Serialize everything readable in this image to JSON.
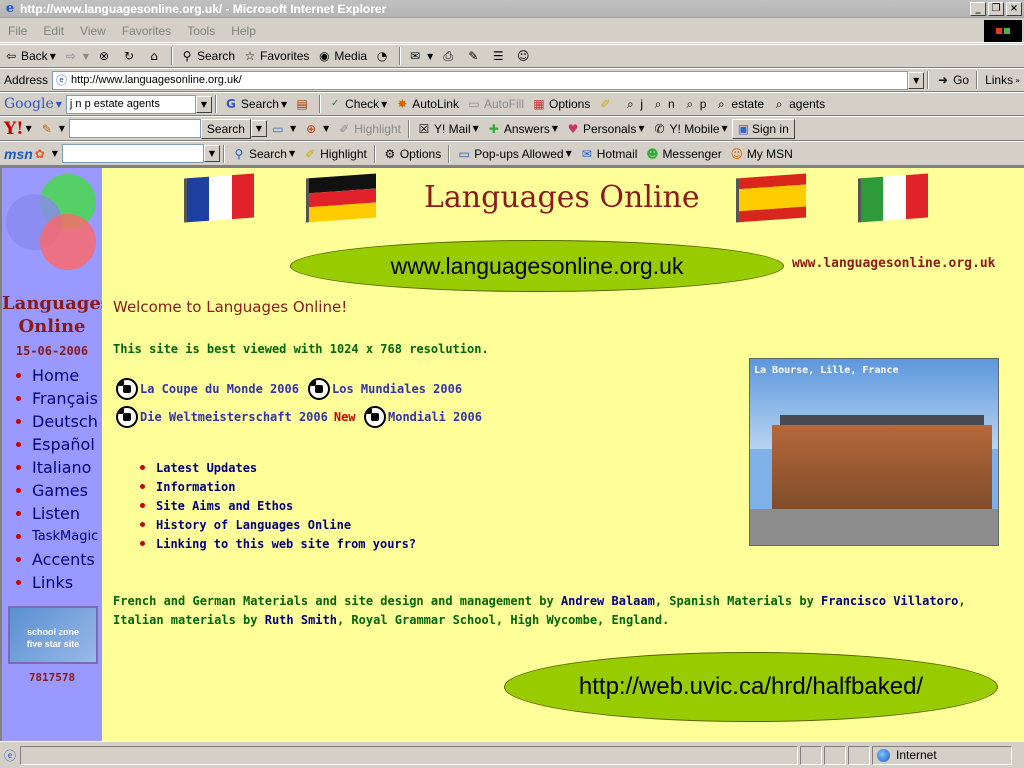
{
  "window": {
    "title": "http://www.languagesonline.org.uk/ - Microsoft Internet Explorer",
    "icon": "ie-icon"
  },
  "menu": [
    "File",
    "Edit",
    "View",
    "Favorites",
    "Tools",
    "Help"
  ],
  "std_toolbar": {
    "back": "Back",
    "search": "Search",
    "favorites": "Favorites",
    "media": "Media"
  },
  "address": {
    "label": "Address",
    "url": "http://www.languagesonline.org.uk/",
    "go": "Go",
    "links": "Links"
  },
  "google": {
    "logo": "Google",
    "query": "j n p estate agents",
    "search": "Search",
    "check": "Check",
    "autolink": "AutoLink",
    "autofill": "AutoFill",
    "options": "Options",
    "terms": [
      "j",
      "n",
      "p",
      "estate",
      "agents"
    ]
  },
  "yahoo": {
    "logo": "Y!",
    "search_btn": "Search",
    "highlight": "Highlight",
    "mail": "Y! Mail",
    "answers": "Answers",
    "personals": "Personals",
    "mobile": "Y! Mobile",
    "signin": "Sign in"
  },
  "msn": {
    "logo": "msn",
    "search": "Search",
    "highlight": "Highlight",
    "options": "Options",
    "popups": "Pop-ups Allowed",
    "hotmail": "Hotmail",
    "messenger": "Messenger",
    "mymsn": "My MSN"
  },
  "page": {
    "title": "Languages Online",
    "url_oval": "www.languagesonline.org.uk",
    "url_right": "www.languagesonline.org.uk",
    "welcome": "Welcome to Languages Online!",
    "best_viewed": "This site is best viewed with 1024 x 768 resolution.",
    "wc1": "La Coupe du Monde 2006",
    "wc2": "Los Mundiales 2006",
    "wc3": "Die Weltmeisterschaft 2006",
    "new_label": "New",
    "wc4": "Mondiali 2006",
    "links": [
      "Latest Updates",
      "Information",
      "Site Aims and Ethos",
      "History of Languages Online",
      "Linking to this web site from yours?"
    ],
    "credits": {
      "p1": "French and German Materials and site design and management by ",
      "n1": "Andrew Balaam",
      "p2": ", Spanish Materials by ",
      "n2": "Francisco Villatoro",
      "p3": ", Italian materials by ",
      "n3": "Ruth Smith",
      "p4": ", Royal Grammar School, High Wycombe, England."
    },
    "photo_caption": "La Bourse, Lille, France",
    "bottom_oval": "http://web.uvic.ca/hrd/halfbaked/"
  },
  "sidebar": {
    "title_line1": "Languages",
    "title_line2": "Online",
    "date": "15-06-2006",
    "nav": [
      "Home",
      "Français",
      "Deutsch",
      "Español",
      "Italiano",
      "Games",
      "Listen",
      "TaskMagic",
      "Accents",
      "Links"
    ],
    "badge_line1": "school zone",
    "badge_line2": "five star site",
    "counter": "7817578"
  },
  "status": {
    "zone": "Internet"
  },
  "colors": {
    "page_bg": "#ffff99",
    "sidebar_bg": "#9999ff",
    "title_red": "#8b1a1a",
    "oval_green": "#99cc00",
    "text_green": "#006600",
    "link_navy": "#000080"
  }
}
